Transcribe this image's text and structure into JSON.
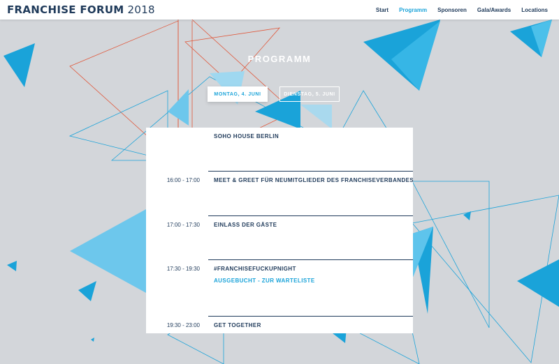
{
  "header": {
    "brand_bold": "FRANCHISE FORUM",
    "brand_year": "2018",
    "nav": [
      {
        "label": "Start",
        "active": false
      },
      {
        "label": "Programm",
        "active": true
      },
      {
        "label": "Sponsoren",
        "active": false
      },
      {
        "label": "Gala/Awards",
        "active": false
      },
      {
        "label": "Locations",
        "active": false
      }
    ]
  },
  "page": {
    "title": "PROGRAMM",
    "tabs": [
      {
        "label": "MONTAG, 4. JUNI",
        "active": true
      },
      {
        "label": "DIENSTAG, 5. JUNI",
        "active": false
      }
    ]
  },
  "schedule": [
    {
      "time": "",
      "event": "SOHO HOUSE BERLIN"
    },
    {
      "time": "16:00 - 17:00",
      "event": "MEET & GREET FÜR NEUMITGLIEDER DES FRANCHISEVERBANDES"
    },
    {
      "time": "17:00 - 17:30",
      "event": "EINLASS DER GÄSTE"
    },
    {
      "time": "17:30 - 19:30",
      "event": "#FRANCHISEFUCKUPNIGHT",
      "sub": "AUSGEBUCHT - ZUR WARTELISTE"
    },
    {
      "time": "19:30 - 23:00",
      "event": "GET TOGETHER"
    }
  ],
  "colors": {
    "accent": "#1aa3d9",
    "navy": "#1f3a5a",
    "background": "#d3d6da",
    "line_red": "#e0573a"
  }
}
